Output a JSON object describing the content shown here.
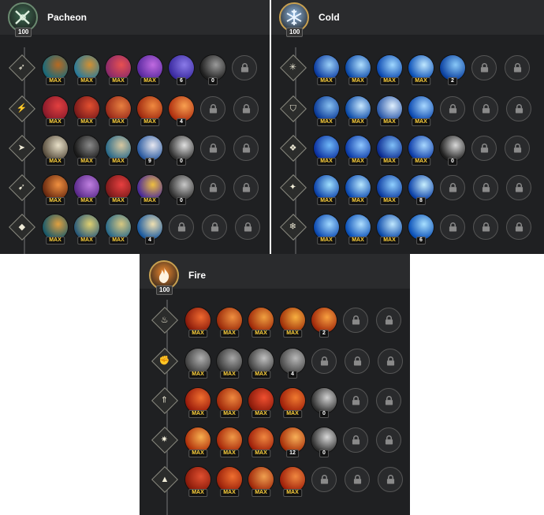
{
  "panels": [
    {
      "title": "Pacheon",
      "level": "100",
      "emblem_icon": "crossed-weapons-icon",
      "accent": "#3e6b52",
      "rows": [
        {
          "icon": "arrows-icon",
          "skills": [
            {
              "tag": "MAX",
              "c1": "#1a6a7a",
              "c2": "#b86a22"
            },
            {
              "tag": "MAX",
              "c1": "#2a7a9a",
              "c2": "#d29032"
            },
            {
              "tag": "MAX",
              "c1": "#8a2a6a",
              "c2": "#e85050"
            },
            {
              "tag": "MAX",
              "c1": "#5a2aa0",
              "c2": "#c06ae0"
            },
            {
              "tag": "6",
              "c1": "#3a2aa0",
              "c2": "#8a7ae8"
            },
            {
              "tag": "0",
              "c1": "#202020",
              "c2": "#9a9a9a"
            }
          ],
          "locks": 1
        },
        {
          "icon": "claws-icon",
          "skills": [
            {
              "tag": "MAX",
              "c1": "#8a1a2a",
              "c2": "#e24040"
            },
            {
              "tag": "MAX",
              "c1": "#7a1a1a",
              "c2": "#e25030"
            },
            {
              "tag": "MAX",
              "c1": "#9a2a1a",
              "c2": "#e88040"
            },
            {
              "tag": "MAX",
              "c1": "#a02a10",
              "c2": "#f08a40"
            },
            {
              "tag": "4",
              "c1": "#b03010",
              "c2": "#f8a050"
            }
          ],
          "locks": 2
        },
        {
          "icon": "hawk-icon",
          "skills": [
            {
              "tag": "MAX",
              "c1": "#5a5040",
              "c2": "#e8e0c8"
            },
            {
              "tag": "MAX",
              "c1": "#1a1a1a",
              "c2": "#8a8a8a"
            },
            {
              "tag": "MAX",
              "c1": "#2a6a8a",
              "c2": "#d8c8a0"
            },
            {
              "tag": "9",
              "c1": "#2a5aa0",
              "c2": "#e8e8f0"
            },
            {
              "tag": "0",
              "c1": "#303030",
              "c2": "#e0e0e0"
            }
          ],
          "locks": 2
        },
        {
          "icon": "feathers-icon",
          "skills": [
            {
              "tag": "MAX",
              "c1": "#6a2a10",
              "c2": "#f09040"
            },
            {
              "tag": "MAX",
              "c1": "#5a2a8a",
              "c2": "#c080e0"
            },
            {
              "tag": "MAX",
              "c1": "#7a1a1a",
              "c2": "#e84040"
            },
            {
              "tag": "MAX",
              "c1": "#4a2a9a",
              "c2": "#f0c040"
            },
            {
              "tag": "0",
              "c1": "#303030",
              "c2": "#c8c8c8"
            }
          ],
          "locks": 2
        },
        {
          "icon": "totem-icon",
          "skills": [
            {
              "tag": "MAX",
              "c1": "#1a5a6a",
              "c2": "#e0a040"
            },
            {
              "tag": "MAX",
              "c1": "#2a5a7a",
              "c2": "#e0d070"
            },
            {
              "tag": "MAX",
              "c1": "#2a6a8a",
              "c2": "#d8c880"
            },
            {
              "tag": "4",
              "c1": "#1a5aa0",
              "c2": "#f0e0b0"
            }
          ],
          "locks": 3
        }
      ]
    },
    {
      "title": "Cold",
      "level": "100",
      "emblem_icon": "snowflake-icon",
      "accent": "#8fb7e0",
      "rows": [
        {
          "icon": "snowflake-icon",
          "skills": [
            {
              "tag": "MAX",
              "c1": "#0a3aa0",
              "c2": "#9ad0f8"
            },
            {
              "tag": "MAX",
              "c1": "#0a48a8",
              "c2": "#b0e0ff"
            },
            {
              "tag": "MAX",
              "c1": "#0a48b0",
              "c2": "#a0d8ff"
            },
            {
              "tag": "MAX",
              "c1": "#0a50b8",
              "c2": "#c0e8ff"
            },
            {
              "tag": "2",
              "c1": "#0a40a0",
              "c2": "#88c8f8"
            }
          ],
          "locks": 2
        },
        {
          "icon": "shield-icon",
          "skills": [
            {
              "tag": "MAX",
              "c1": "#0a3a98",
              "c2": "#88c0f0"
            },
            {
              "tag": "MAX",
              "c1": "#0a4aa8",
              "c2": "#c8e8ff"
            },
            {
              "tag": "MAX",
              "c1": "#2a58a8",
              "c2": "#e0f0ff"
            },
            {
              "tag": "MAX",
              "c1": "#0a48b0",
              "c2": "#a8d8ff"
            }
          ],
          "locks": 3
        },
        {
          "icon": "shard-icon",
          "skills": [
            {
              "tag": "MAX",
              "c1": "#0a30a0",
              "c2": "#70b8f8"
            },
            {
              "tag": "MAX",
              "c1": "#0a3aa8",
              "c2": "#90c8ff"
            },
            {
              "tag": "MAX",
              "c1": "#0a2a90",
              "c2": "#80c0f8"
            },
            {
              "tag": "MAX",
              "c1": "#0a3aa8",
              "c2": "#a8d8ff"
            },
            {
              "tag": "0",
              "c1": "#202020",
              "c2": "#d8d8d8"
            }
          ],
          "locks": 2
        },
        {
          "icon": "crystal-icon",
          "skills": [
            {
              "tag": "MAX",
              "c1": "#0a40a8",
              "c2": "#a0e0ff"
            },
            {
              "tag": "MAX",
              "c1": "#0a48b0",
              "c2": "#b8e8ff"
            },
            {
              "tag": "MAX",
              "c1": "#0a3aa0",
              "c2": "#90d0ff"
            },
            {
              "tag": "8",
              "c1": "#0a40a8",
              "c2": "#c8f0ff"
            }
          ],
          "locks": 3
        },
        {
          "icon": "frost-drop-icon",
          "skills": [
            {
              "tag": "MAX",
              "c1": "#0a48b0",
              "c2": "#a0d8ff"
            },
            {
              "tag": "MAX",
              "c1": "#0a50b8",
              "c2": "#b0e0ff"
            },
            {
              "tag": "MAX",
              "c1": "#0a48a8",
              "c2": "#c0e8ff"
            },
            {
              "tag": "6",
              "c1": "#0a50b8",
              "c2": "#a8e0ff"
            }
          ],
          "locks": 3
        }
      ]
    },
    {
      "title": "Fire",
      "level": "100",
      "emblem_icon": "flame-icon",
      "accent": "#f08a30",
      "rows": [
        {
          "icon": "flame-icon",
          "skills": [
            {
              "tag": "MAX",
              "c1": "#8a1a0a",
              "c2": "#f06a30"
            },
            {
              "tag": "MAX",
              "c1": "#9a2a0a",
              "c2": "#f09040"
            },
            {
              "tag": "MAX",
              "c1": "#a02a0a",
              "c2": "#f0a040"
            },
            {
              "tag": "MAX",
              "c1": "#a0300a",
              "c2": "#f8b040"
            },
            {
              "tag": "2",
              "c1": "#a0280a",
              "c2": "#f8a040"
            }
          ],
          "locks": 2
        },
        {
          "icon": "flame-fist-icon",
          "skills": [
            {
              "tag": "MAX",
              "c1": "#404040",
              "c2": "#b0b0b0"
            },
            {
              "tag": "MAX",
              "c1": "#383838",
              "c2": "#a8a8a8"
            },
            {
              "tag": "MAX",
              "c1": "#404040",
              "c2": "#c0c0c0"
            },
            {
              "tag": "4",
              "c1": "#484848",
              "c2": "#b8b8b8"
            }
          ],
          "locks": 3
        },
        {
          "icon": "fire-arrow-icon",
          "skills": [
            {
              "tag": "MAX",
              "c1": "#9a1a0a",
              "c2": "#f07030"
            },
            {
              "tag": "MAX",
              "c1": "#a0280a",
              "c2": "#f08a40"
            },
            {
              "tag": "MAX",
              "c1": "#8a1a0a",
              "c2": "#f05030"
            },
            {
              "tag": "MAX",
              "c1": "#a0200a",
              "c2": "#f07a30"
            },
            {
              "tag": "0",
              "c1": "#303030",
              "c2": "#d0d0d0"
            }
          ],
          "locks": 2
        },
        {
          "icon": "fire-burst-icon",
          "skills": [
            {
              "tag": "MAX",
              "c1": "#b0300a",
              "c2": "#f8b050"
            },
            {
              "tag": "MAX",
              "c1": "#a8280a",
              "c2": "#f09a48"
            },
            {
              "tag": "MAX",
              "c1": "#a0200a",
              "c2": "#f08840"
            },
            {
              "tag": "12",
              "c1": "#a8300a",
              "c2": "#f8b058"
            },
            {
              "tag": "0",
              "c1": "#303030",
              "c2": "#d8d8d8"
            }
          ],
          "locks": 2
        },
        {
          "icon": "fire-wall-icon",
          "skills": [
            {
              "tag": "MAX",
              "c1": "#8a1a0a",
              "c2": "#e05030"
            },
            {
              "tag": "MAX",
              "c1": "#9a200a",
              "c2": "#f07030"
            },
            {
              "tag": "MAX",
              "c1": "#a0280a",
              "c2": "#f0a050"
            },
            {
              "tag": "MAX",
              "c1": "#a0200a",
              "c2": "#f08840"
            }
          ],
          "locks": 3
        }
      ]
    }
  ]
}
